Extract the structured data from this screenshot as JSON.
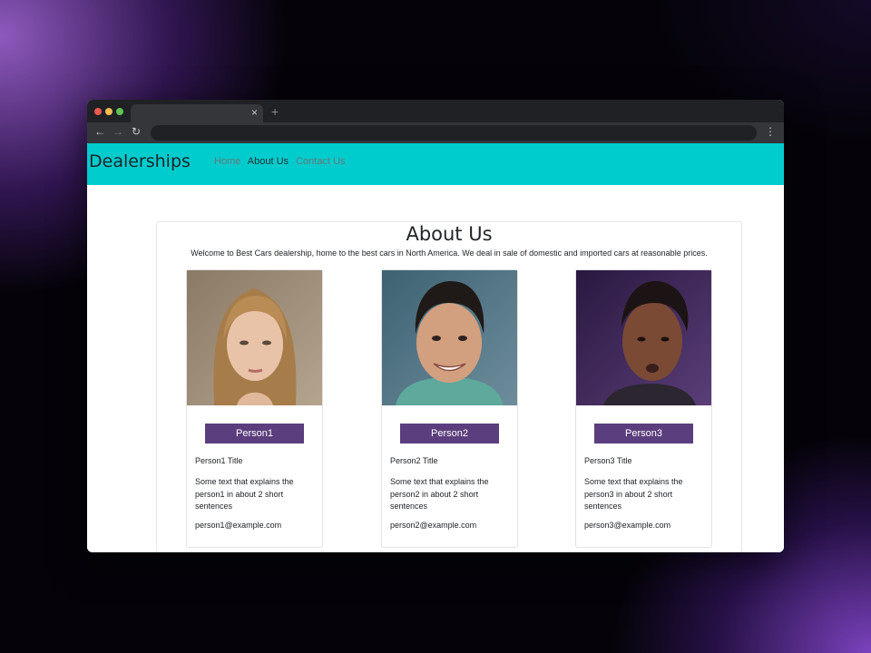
{
  "browser": {
    "tab_close": "×",
    "new_tab": "+",
    "back": "←",
    "forward": "→",
    "reload": "↻",
    "menu": "⋮"
  },
  "navbar": {
    "brand": "Dealerships",
    "links": [
      {
        "label": "Home"
      },
      {
        "label": "About Us",
        "active": true
      },
      {
        "label": "Contact Us"
      }
    ]
  },
  "about": {
    "title": "About Us",
    "intro": "Welcome to Best Cars dealership, home to the best cars in North America. We deal in sale of domestic and imported cars at reasonable prices."
  },
  "people": [
    {
      "name": "Person1",
      "title": "Person1 Title",
      "description": "Some text that explains the person1 in about 2 short sentences",
      "email": "person1@example.com"
    },
    {
      "name": "Person2",
      "title": "Person2 Title",
      "description": "Some text that explains the person2 in about 2 short sentences",
      "email": "person2@example.com"
    },
    {
      "name": "Person3",
      "title": "Person3 Title",
      "description": "Some text that explains the person3 in about 2 short sentences",
      "email": "person3@example.com"
    }
  ],
  "colors": {
    "navbar_bg": "#00cccd",
    "button_bg": "#5b3e7d"
  }
}
